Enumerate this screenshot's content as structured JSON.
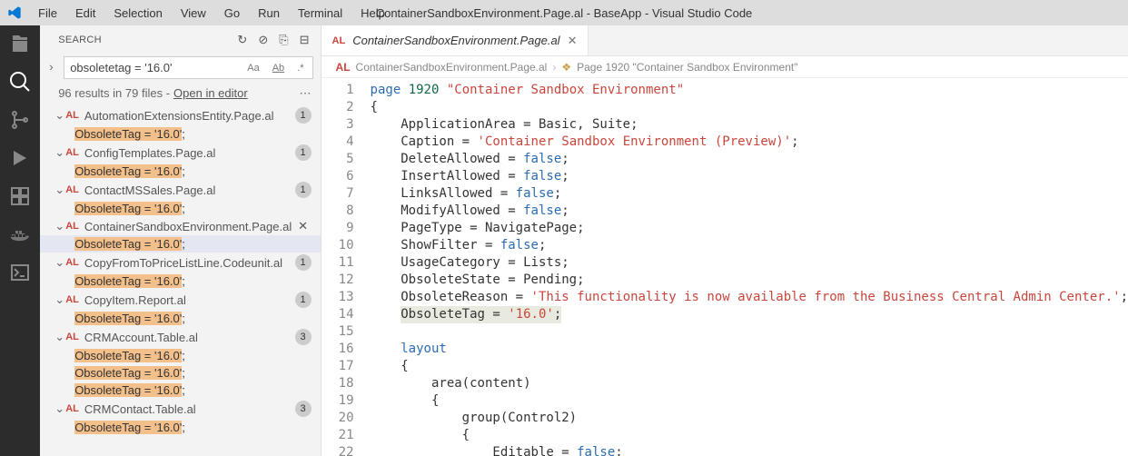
{
  "window_title": "ContainerSandboxEnvironment.Page.al - BaseApp - Visual Studio Code",
  "menu": [
    "File",
    "Edit",
    "Selection",
    "View",
    "Go",
    "Run",
    "Terminal",
    "Help"
  ],
  "sidebar": {
    "title": "Search",
    "query": "obsoletetag = '16.0'",
    "summary_prefix": "96 results in 79 files - ",
    "summary_link": "Open in editor",
    "files": [
      {
        "name": "AutomationExtensionsEntity.Page.al",
        "count": "1",
        "matches": [
          "ObsoleteTag = '16.0';"
        ],
        "selected": false
      },
      {
        "name": "ConfigTemplates.Page.al",
        "count": "1",
        "matches": [
          "ObsoleteTag = '16.0';"
        ],
        "selected": false
      },
      {
        "name": "ContactMSSales.Page.al",
        "count": "1",
        "matches": [
          "ObsoleteTag = '16.0';"
        ],
        "selected": false
      },
      {
        "name": "ContainerSandboxEnvironment.Page.al",
        "count": "1",
        "matches": [
          "ObsoleteTag = '16.0';"
        ],
        "selected": true,
        "showClose": true
      },
      {
        "name": "CopyFromToPriceListLine.Codeunit.al",
        "count": "1",
        "matches": [
          "ObsoleteTag = '16.0';"
        ],
        "selected": false
      },
      {
        "name": "CopyItem.Report.al",
        "count": "1",
        "matches": [
          "ObsoleteTag = '16.0';"
        ],
        "selected": false
      },
      {
        "name": "CRMAccount.Table.al",
        "count": "3",
        "matches": [
          "ObsoleteTag = '16.0';",
          "ObsoleteTag = '16.0';",
          "ObsoleteTag = '16.0';"
        ],
        "selected": false
      },
      {
        "name": "CRMContact.Table.al",
        "count": "3",
        "matches": [
          "ObsoleteTag = '16.0';"
        ],
        "selected": false,
        "partial": true
      }
    ]
  },
  "tab": {
    "lang": "AL",
    "title": "ContainerSandboxEnvironment.Page.al"
  },
  "breadcrumbs": {
    "file": "ContainerSandboxEnvironment.Page.al",
    "symbol": "Page 1920 \"Container Sandbox Environment\""
  },
  "code": {
    "lines": [
      {
        "n": "1",
        "h": "<span class='tok-kw'>page</span> <span class='tok-num'>1920</span> <span class='tok-str'>\"Container Sandbox Environment\"</span>"
      },
      {
        "n": "2",
        "h": "{"
      },
      {
        "n": "3",
        "h": "    ApplicationArea = Basic, Suite;"
      },
      {
        "n": "4",
        "h": "    Caption = <span class='tok-str'>'Container Sandbox Environment (Preview)'</span>;"
      },
      {
        "n": "5",
        "h": "    DeleteAllowed = <span class='tok-kw'>false</span>;"
      },
      {
        "n": "6",
        "h": "    InsertAllowed = <span class='tok-kw'>false</span>;"
      },
      {
        "n": "7",
        "h": "    LinksAllowed = <span class='tok-kw'>false</span>;"
      },
      {
        "n": "8",
        "h": "    ModifyAllowed = <span class='tok-kw'>false</span>;"
      },
      {
        "n": "9",
        "h": "    PageType = NavigatePage;"
      },
      {
        "n": "10",
        "h": "    ShowFilter = <span class='tok-kw'>false</span>;"
      },
      {
        "n": "11",
        "h": "    UsageCategory = Lists;"
      },
      {
        "n": "12",
        "h": "    ObsoleteState = Pending;"
      },
      {
        "n": "13",
        "h": "    ObsoleteReason = <span class='tok-str'>'This functionality is now available from the Business Central Admin Center.'</span>;"
      },
      {
        "n": "14",
        "h": "    <span class='hl-line'>ObsoleteTag = <span class='tok-str'>'16.0'</span>;</span>"
      },
      {
        "n": "15",
        "h": ""
      },
      {
        "n": "16",
        "h": "    <span class='tok-kw'>layout</span>"
      },
      {
        "n": "17",
        "h": "    {"
      },
      {
        "n": "18",
        "h": "        area(content)"
      },
      {
        "n": "19",
        "h": "        {"
      },
      {
        "n": "20",
        "h": "            group(Control2)"
      },
      {
        "n": "21",
        "h": "            {"
      },
      {
        "n": "22",
        "h": "                Editable = <span class='tok-kw'>false</span>;"
      }
    ]
  }
}
